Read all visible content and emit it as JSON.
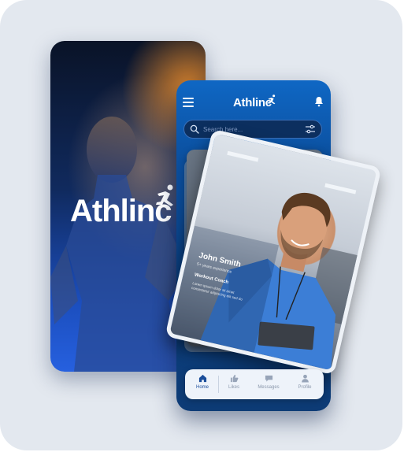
{
  "splash": {
    "logo_text": "Athlinc"
  },
  "app": {
    "logo_text": "Athlinc",
    "search": {
      "placeholder": "Search here..."
    },
    "profile_card": {
      "name": "John Smith",
      "subtitle": "5+ years experience",
      "role": "Workout Coach",
      "description": "Lorem ipsum dolor sit amet consectetur adipiscing elit sed do"
    },
    "bottom_nav": [
      {
        "label": "Home",
        "icon": "home-icon",
        "active": true
      },
      {
        "label": "Likes",
        "icon": "thumbs-up-icon",
        "active": false
      },
      {
        "label": "Messages",
        "icon": "chat-icon",
        "active": false
      },
      {
        "label": "Profile",
        "icon": "user-icon",
        "active": false
      }
    ]
  },
  "colors": {
    "brand_blue": "#0b4c99",
    "background": "#e3e8ef",
    "accent_orange": "#ff9628"
  }
}
